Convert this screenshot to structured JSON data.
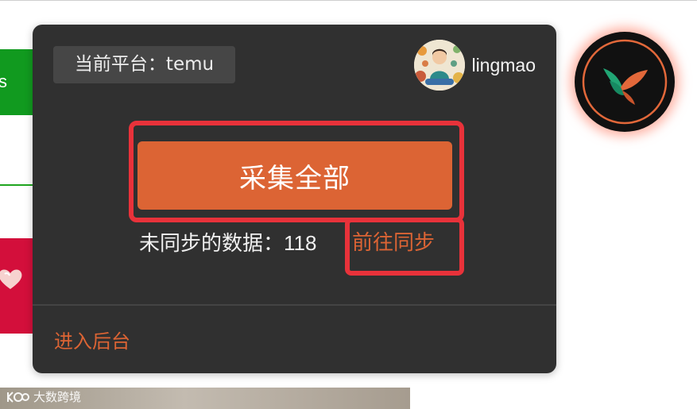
{
  "popup": {
    "platform_label": "当前平台：temu",
    "user": {
      "name": "lingmao"
    },
    "collect_all_label": "采集全部",
    "unsynced": {
      "label": "未同步的数据：",
      "count": "118"
    },
    "sync_link": "前往同步",
    "backend_link": "进入后台"
  },
  "background": {
    "green_fragment_text": "s",
    "watermark_text": "大数跨境"
  },
  "colors": {
    "accent": "#dc6434",
    "panel": "#303030",
    "highlight": "#e8323a"
  },
  "icons": [
    "avatar-illustration",
    "bird-logo-icon",
    "heart-icon",
    "watermark-logo-icon"
  ]
}
